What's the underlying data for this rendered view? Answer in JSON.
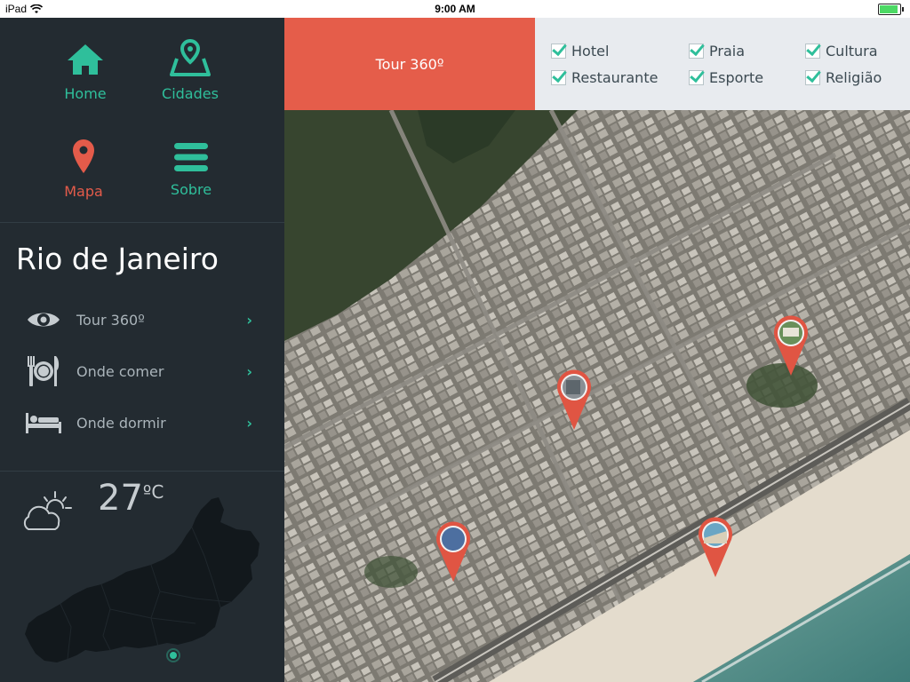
{
  "status_bar": {
    "device": "iPad",
    "time": "9:00 AM"
  },
  "nav": {
    "home": "Home",
    "cities": "Cidades",
    "map": "Mapa",
    "about": "Sobre"
  },
  "city": {
    "name": "Rio de Janeiro"
  },
  "menu": [
    {
      "label": "Tour 360º",
      "icon": "eye-icon"
    },
    {
      "label": "Onde comer",
      "icon": "plate-cutlery-icon"
    },
    {
      "label": "Onde dormir",
      "icon": "bed-icon"
    }
  ],
  "weather": {
    "temp": "27",
    "unit": "ºC",
    "icon": "partly-cloudy-icon"
  },
  "top_bar": {
    "tour_label": "Tour 360º",
    "filters": [
      {
        "label": "Hotel",
        "checked": true
      },
      {
        "label": "Praia",
        "checked": true
      },
      {
        "label": "Cultura",
        "checked": true
      },
      {
        "label": "Restaurante",
        "checked": true
      },
      {
        "label": "Esporte",
        "checked": true
      },
      {
        "label": "Religião",
        "checked": true
      }
    ]
  },
  "colors": {
    "accent_teal": "#2fbf9b",
    "accent_coral": "#e55d4a",
    "sidebar_bg": "#232b31",
    "filters_bg": "#e8ebef"
  }
}
